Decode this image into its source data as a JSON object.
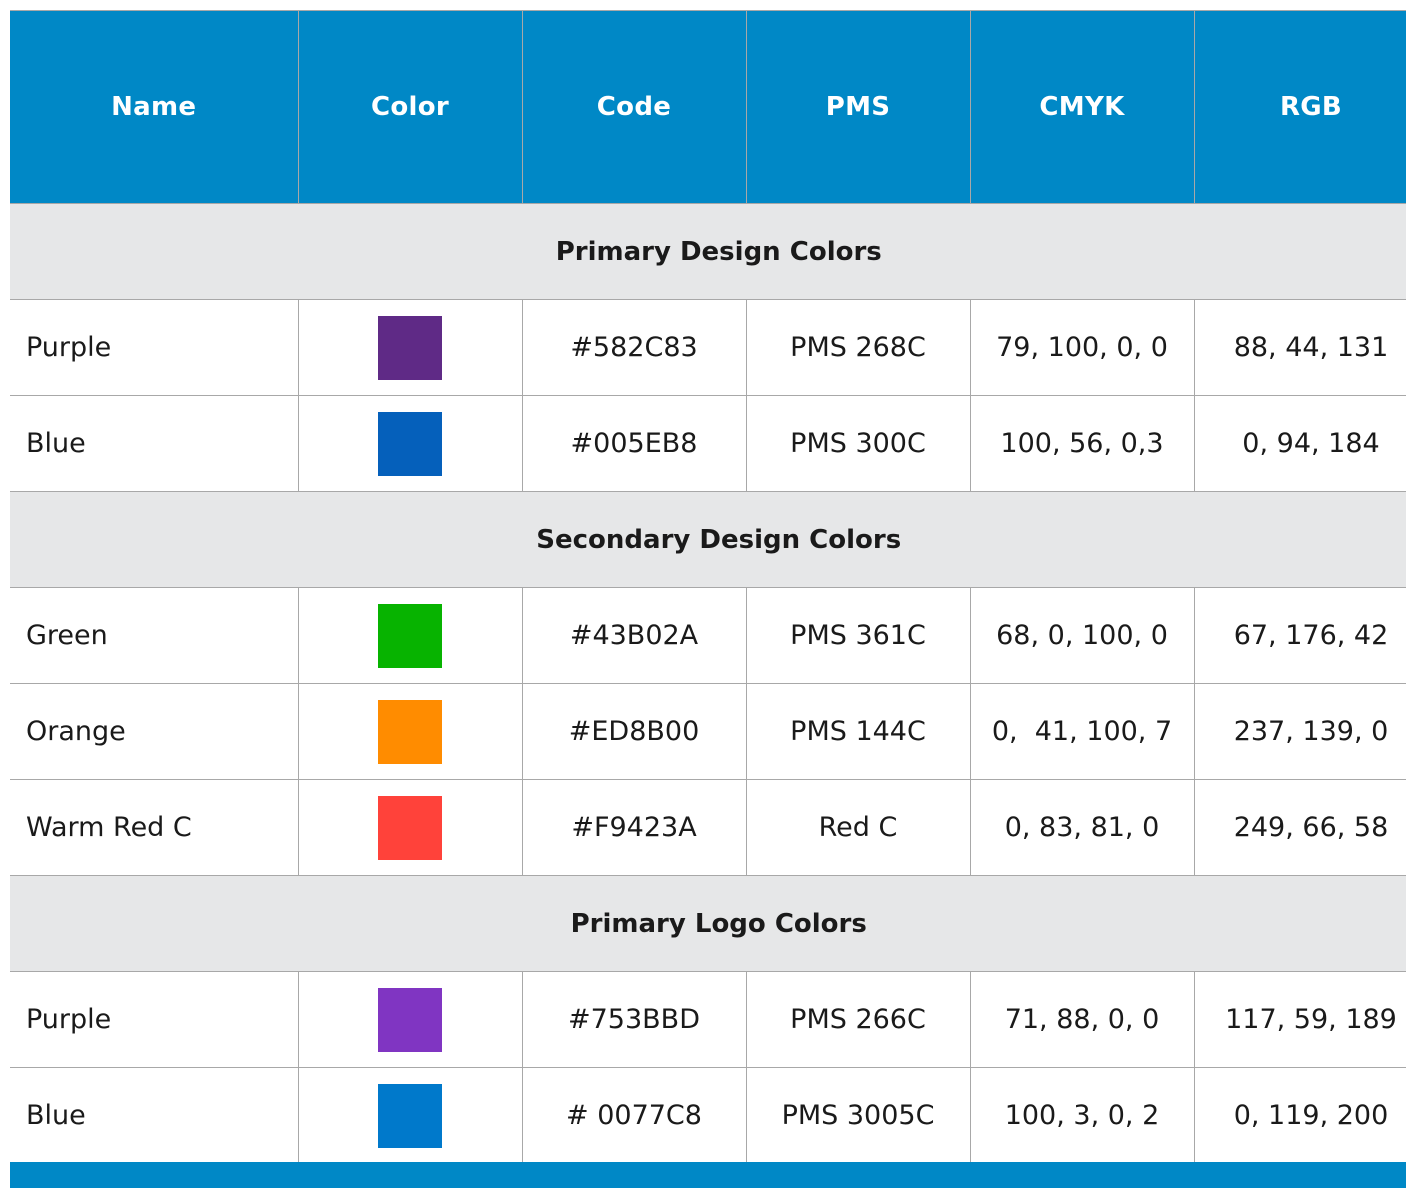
{
  "header": {
    "name": "Name",
    "color": "Color",
    "code": "Code",
    "pms": "PMS",
    "cmyk": "CMYK",
    "rgb": "RGB"
  },
  "groups": [
    {
      "title": "Primary Design Colors",
      "rows": [
        {
          "name": "Purple",
          "swatch": "#5F2A86",
          "code": "#582C83",
          "pms": "PMS 268C",
          "cmyk": "79, 100, 0, 0",
          "rgb": "88, 44, 131"
        },
        {
          "name": "Blue",
          "swatch": "#0560BB",
          "code": "#005EB8",
          "pms": "PMS 300C",
          "cmyk": "100, 56, 0,3",
          "rgb": "0, 94, 184"
        }
      ]
    },
    {
      "title": "Secondary Design Colors",
      "rows": [
        {
          "name": "Green",
          "swatch": "#07B300",
          "code": "#43B02A",
          "pms": "PMS 361C",
          "cmyk": "68, 0, 100, 0",
          "rgb": "67, 176, 42"
        },
        {
          "name": "Orange",
          "swatch": "#FF8C00",
          "code": "#ED8B00",
          "pms": "PMS 144C",
          "cmyk": "0,  41, 100, 7",
          "rgb": "237, 139, 0"
        },
        {
          "name": "Warm Red C",
          "swatch": "#FF423A",
          "code": "#F9423A",
          "pms": "Red C",
          "cmyk": "0, 83, 81, 0",
          "rgb": "249, 66, 58"
        }
      ]
    },
    {
      "title": "Primary Logo Colors",
      "rows": [
        {
          "name": "Purple",
          "swatch": "#8035C2",
          "code": "#753BBD",
          "pms": "PMS 266C",
          "cmyk": "71, 88, 0, 0",
          "rgb": "117, 59, 189"
        },
        {
          "name": "Blue",
          "swatch": "#0079CB",
          "code": "# 0077C8",
          "pms": "PMS 3005C",
          "cmyk": "100, 3, 0, 2",
          "rgb": "0, 119, 200"
        }
      ]
    }
  ],
  "colors": {
    "header_bg": "#0088C6",
    "group_bg": "#E6E7E8",
    "border": "#A8A8A8"
  }
}
